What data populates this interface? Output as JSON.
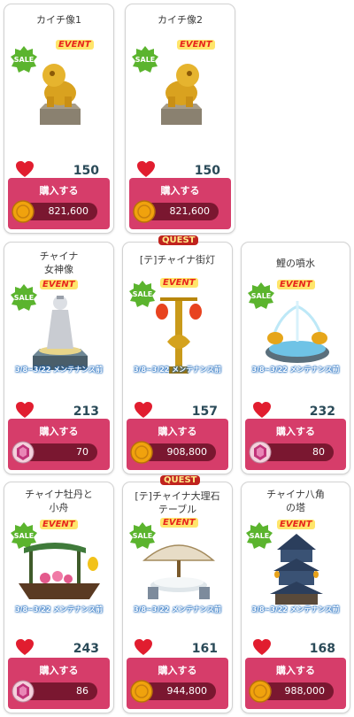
{
  "buy_label": "購入する",
  "sale_text": "SALE",
  "event_text": "EVENT",
  "quest_text": "QUEST",
  "items": [
    {
      "title": "カイチ像1",
      "likes": "150",
      "price": "821,600",
      "currency": "coin"
    },
    {
      "title": "カイチ像2",
      "likes": "150",
      "price": "821,600",
      "currency": "coin"
    },
    {
      "title": "チャイナ\n女神像",
      "likes": "213",
      "price": "70",
      "currency": "gem",
      "maintenance": "3/8~3/22 メンテナンス前"
    },
    {
      "title": "[テ]チャイナ街灯",
      "likes": "157",
      "price": "908,800",
      "currency": "coin",
      "maintenance": "3/8~3/22 メンテナンス前"
    },
    {
      "title": "鯉の噴水",
      "likes": "232",
      "price": "80",
      "currency": "gem",
      "maintenance": "3/8~3/22 メンテナンス前"
    },
    {
      "title": "チャイナ牡丹と\n小舟",
      "likes": "243",
      "price": "86",
      "currency": "gem",
      "maintenance": "3/8~3/22 メンテナンス前"
    },
    {
      "title": "[テ]チャイナ大理石\nテーブル",
      "likes": "161",
      "price": "944,800",
      "currency": "coin",
      "maintenance": "3/8~3/22 メンテナンス前"
    },
    {
      "title": "チャイナ八角\nの塔",
      "likes": "168",
      "price": "988,000",
      "currency": "coin",
      "maintenance": "3/8~3/22 メンテナンス前"
    }
  ],
  "colors": {
    "buy_bg": "#d63d6a",
    "price_bar": "#7a1730",
    "heart": "#e11d2f",
    "likes_text": "#2a4a58"
  }
}
